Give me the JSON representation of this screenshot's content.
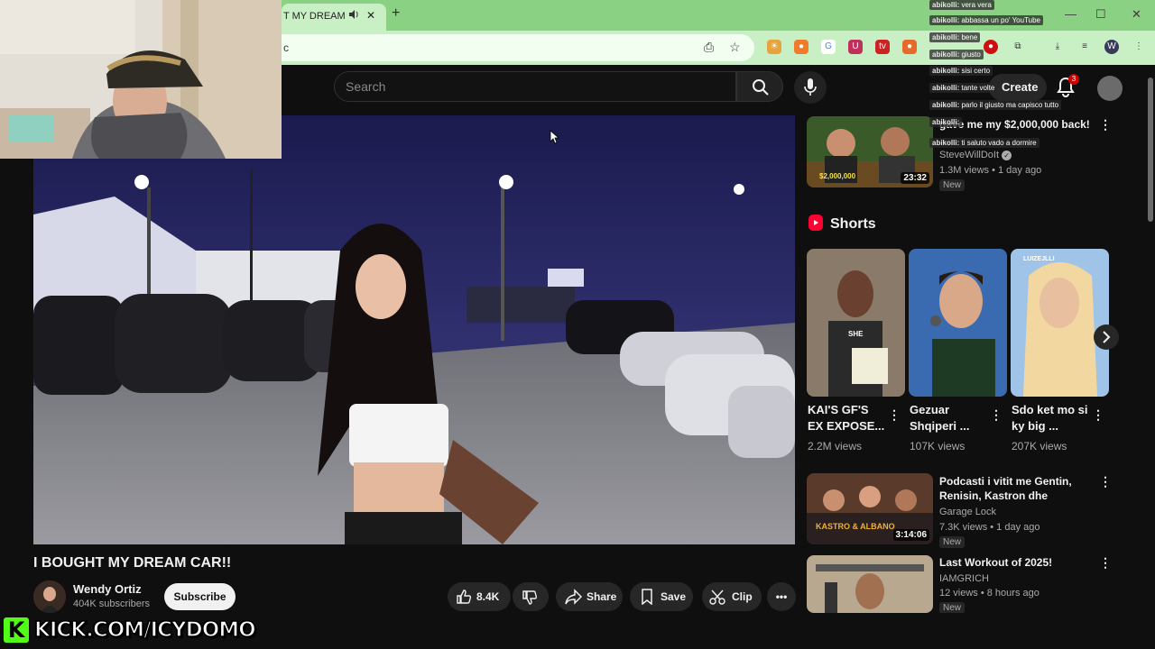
{
  "browser": {
    "tab_title": "T MY DREAM C",
    "address_text": "c"
  },
  "youtube": {
    "search_placeholder": "Search",
    "create_label": "Create",
    "notification_count": "3"
  },
  "video": {
    "title": "I BOUGHT MY DREAM CAR!!",
    "channel_name": "Wendy Ortiz",
    "subscribers": "404K subscribers",
    "subscribe_label": "Subscribe",
    "like_count": "8.4K",
    "share_label": "Share",
    "save_label": "Save",
    "clip_label": "Clip"
  },
  "recommendations": [
    {
      "title": "gave me my $2,000,000 back!",
      "channel": "SteveWillDoIt",
      "meta": "1.3M views • 1 day ago",
      "duration": "23:32",
      "badge": "New",
      "thumb_text": "$2,000,000"
    },
    {
      "title": "Podcasti i vitit me Gentin, Renisin, Kastron dhe Albanon ...",
      "channel": "Garage Lock",
      "meta": "7.3K views • 1 day ago",
      "duration": "3:14:06",
      "badge": "New",
      "thumb_text": "KASTRO & ALBANO"
    },
    {
      "title": "Last Workout of 2025!",
      "channel": "IAMGRICH",
      "meta": "12 views • 8 hours ago",
      "badge": "New"
    }
  ],
  "shorts": {
    "label": "Shorts",
    "items": [
      {
        "title": "KAI'S GF'S EX EXPOSE...",
        "views": "2.2M views",
        "thumb_text": "SHE"
      },
      {
        "title": "Gezuar Shqiperi ...",
        "views": "107K views"
      },
      {
        "title": "Sdo ket mo si ky big ...",
        "views": "207K views",
        "thumb_text": "LUIZEJLLI"
      }
    ]
  },
  "chat": [
    {
      "user": "abikolli:",
      "msg": "vera vera"
    },
    {
      "user": "abikolli:",
      "msg": "abbassa un po' YouTube"
    },
    {
      "user": "abikolli:",
      "msg": "bene"
    },
    {
      "user": "abikolli:",
      "msg": "giusto"
    },
    {
      "user": "abikolli:",
      "msg": "sisi certo"
    },
    {
      "user": "abikolli:",
      "msg": "tante volte"
    },
    {
      "user": "abikolli:",
      "msg": "parlo il giusto ma capisco tutto"
    },
    {
      "user": "abikolli:",
      "msg": ""
    },
    {
      "user": "abikolli:",
      "msg": "ti saluto vado a dormire"
    }
  ],
  "stream_banner": {
    "logo_letter": "K",
    "url": "KICK.COM/ICYDOMO"
  },
  "icons": {
    "search": "search-icon",
    "mic": "microphone-icon",
    "bell": "bell-icon",
    "like": "thumbs-up-icon",
    "dislike": "thumbs-down-icon",
    "share": "share-arrow-icon",
    "save": "bookmark-icon",
    "clip": "scissors-icon"
  },
  "colors": {
    "browser_frame": "#8bd183",
    "youtube_red": "#ff0033",
    "kick_green": "#53fc18",
    "background": "#0f0f0f"
  }
}
